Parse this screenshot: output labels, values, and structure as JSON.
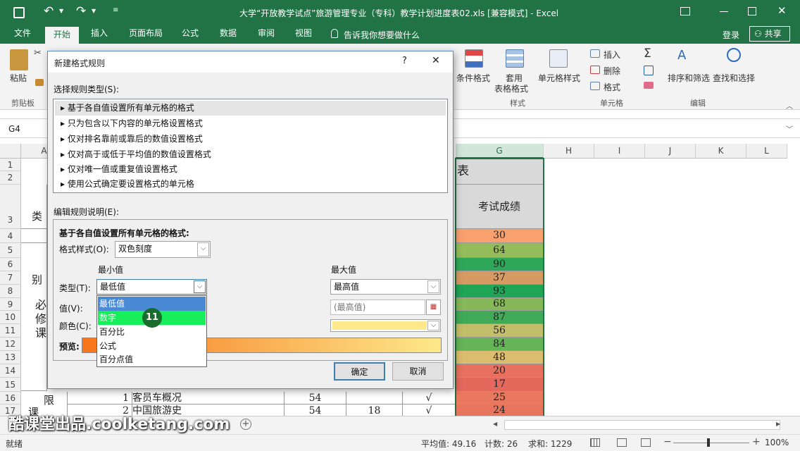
{
  "window": {
    "title": "大学“开放教学试点”旅游管理专业（专科）教学计划进度表02.xls  [兼容模式] - Excel"
  },
  "tabs": [
    "文件",
    "开始",
    "插入",
    "页面布局",
    "公式",
    "数据",
    "审阅",
    "视图"
  ],
  "tell_me": "告诉我你想要做什么",
  "login": "登录",
  "share": "共享",
  "ribbon": {
    "paste": "粘贴",
    "clipboard": "剪贴板",
    "cond_format": "条件格式",
    "table_format_1": "套用",
    "table_format_2": "表格格式",
    "cell_style": "单元格样式",
    "styles_group": "样式",
    "insert": "插入",
    "delete": "删除",
    "format": "格式",
    "cells_group": "单元格",
    "sort_filter": "排序和筛选",
    "find_select": "查找和选择",
    "edit_group": "编辑"
  },
  "namebox": "G4",
  "columns": [
    "A",
    "G",
    "H",
    "I",
    "J",
    "K",
    "L"
  ],
  "rows": [
    "1",
    "2",
    "3",
    "4",
    "5",
    "6",
    "7",
    "8",
    "9",
    "10",
    "11",
    "12",
    "13",
    "14",
    "15",
    "16",
    "17"
  ],
  "sheet": {
    "title_frag": "表",
    "exam_header": "考试成绩",
    "category_frag": "类别",
    "compulsory": [
      "必",
      "修",
      "课"
    ],
    "limited": [
      "限",
      "课"
    ],
    "scores": [
      "30",
      "64",
      "90",
      "37",
      "93",
      "68",
      "87",
      "56",
      "84",
      "48",
      "20",
      "17",
      "25",
      "24"
    ],
    "score_colors": [
      "#f8a06e",
      "#94bc5a",
      "#2ea858",
      "#d79a62",
      "#20a456",
      "#86b858",
      "#40aa58",
      "#c2be6a",
      "#66b458",
      "#dcbc6e",
      "#e8705e",
      "#e4685c",
      "#e8785e",
      "#e8765e"
    ],
    "row16": {
      "num": "1",
      "course": "客员车概况",
      "v1": "54",
      "check": "√"
    },
    "row17": {
      "num": "2",
      "course": "中国旅游史",
      "v1": "54",
      "v2": "18",
      "check": "√"
    }
  },
  "dialog": {
    "title": "新建格式规则",
    "help": "?",
    "close": "✕",
    "select_type_label": "选择规则类型(S):",
    "rule_types": [
      "基于各自值设置所有单元格的格式",
      "只为包含以下内容的单元格设置格式",
      "仅对排名靠前或靠后的数值设置格式",
      "仅对高于或低于平均值的数值设置格式",
      "仅对唯一值或重复值设置格式",
      "使用公式确定要设置格式的单元格"
    ],
    "edit_label": "编辑规则说明(E):",
    "desc_title": "基于各自值设置所有单元格的格式:",
    "format_style_label": "格式样式(O):",
    "format_style_value": "双色刻度",
    "min_label": "最小值",
    "max_label": "最大值",
    "type_label": "类型(T):",
    "value_label": "值(V):",
    "color_label": "颜色(C):",
    "min_type_value": "最低值",
    "max_type_value": "最高值",
    "max_value_placeholder": "(最高值)",
    "preview_label": "预览:",
    "dropdown_options": [
      "最低值",
      "数字",
      "百分比",
      "公式",
      "百分点值"
    ],
    "highlighted_option": "数字",
    "step_badge": "11",
    "ok": "确定",
    "cancel": "取消",
    "min_color": "#f8741c",
    "max_color": "#fde98a"
  },
  "watermark": "酷课堂出品.coolketang.com",
  "status": {
    "ready": "就绪",
    "average": "平均值: 49.16",
    "count": "计数: 26",
    "sum": "求和: 1229",
    "zoom": "100%"
  }
}
